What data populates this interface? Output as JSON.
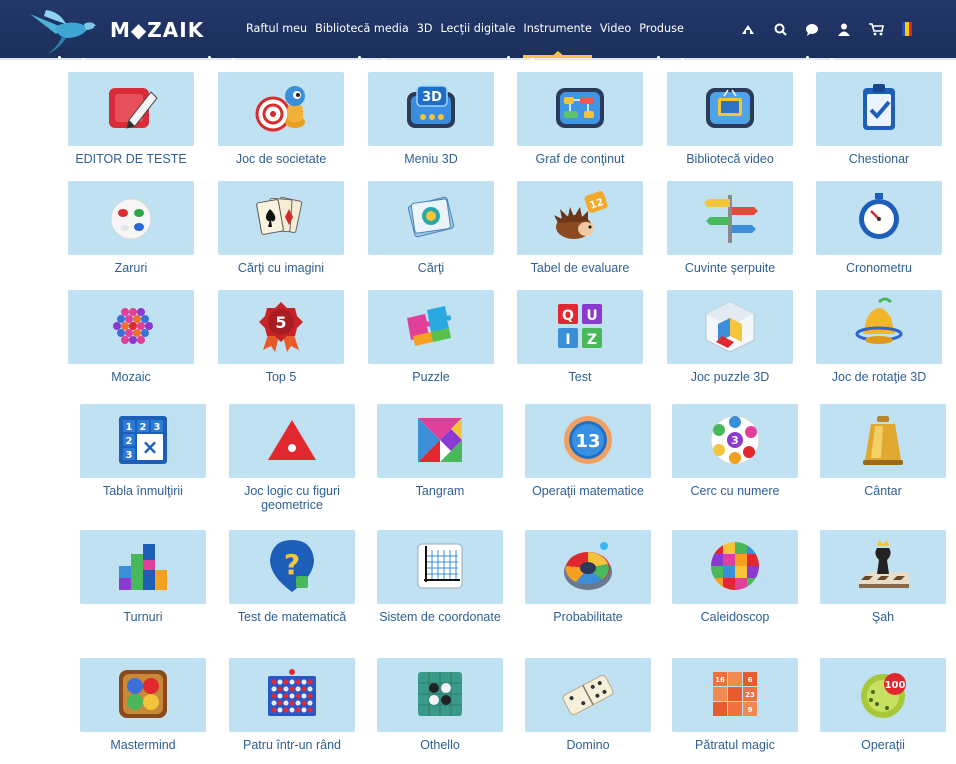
{
  "header": {
    "logo_text": "M◆ZAIK",
    "nav": [
      {
        "label": "Raftul meu"
      },
      {
        "label": "Bibliotecă media"
      },
      {
        "label": "3D"
      },
      {
        "label": "Lecţii digitale"
      },
      {
        "label": "Instrumente",
        "active": true
      },
      {
        "label": "Video"
      },
      {
        "label": "Produse"
      }
    ],
    "icons": [
      "account-lock-icon",
      "search-icon",
      "chat-icon",
      "user-icon",
      "cart-icon",
      "language-flag-icon"
    ],
    "accent_color": "#f5c542",
    "bar_color": "#22386a"
  },
  "tools": [
    {
      "label": "EDITOR DE TESTE",
      "icon": "test-editor-icon"
    },
    {
      "label": "Joc de societate",
      "icon": "board-game-icon"
    },
    {
      "label": "Meniu 3D",
      "icon": "menu-3d-icon"
    },
    {
      "label": "Graf de conţinut",
      "icon": "content-graph-icon"
    },
    {
      "label": "Bibliotecă video",
      "icon": "video-library-icon"
    },
    {
      "label": "Chestionar",
      "icon": "questionnaire-icon"
    },
    {
      "label": "Zaruri",
      "icon": "dice-icon"
    },
    {
      "label": "Cărţi cu imagini",
      "icon": "picture-cards-icon"
    },
    {
      "label": "Cărţi",
      "icon": "cards-icon"
    },
    {
      "label": "Tabel de evaluare",
      "icon": "evaluation-table-icon"
    },
    {
      "label": "Cuvinte şerpuite",
      "icon": "snake-words-icon"
    },
    {
      "label": "Cronometru",
      "icon": "stopwatch-icon"
    },
    {
      "label": "Mozaic",
      "icon": "mosaic-icon"
    },
    {
      "label": "Top 5",
      "icon": "top5-icon"
    },
    {
      "label": "Puzzle",
      "icon": "puzzle-icon"
    },
    {
      "label": "Test",
      "icon": "quiz-icon"
    },
    {
      "label": "Joc puzzle 3D",
      "icon": "puzzle-3d-icon"
    },
    {
      "label": "Joc de rotaţie 3D",
      "icon": "rotation-3d-icon"
    },
    {
      "label": "Tabla înmulţirii",
      "icon": "multiplication-table-icon"
    },
    {
      "label": "Joc logic cu figuri geometrice",
      "icon": "geometric-logic-icon"
    },
    {
      "label": "Tangram",
      "icon": "tangram-icon"
    },
    {
      "label": "Operaţii matematice",
      "icon": "math-operations-icon"
    },
    {
      "label": "Cerc cu numere",
      "icon": "number-circle-icon"
    },
    {
      "label": "Cântar",
      "icon": "scale-weight-icon"
    },
    {
      "label": "Turnuri",
      "icon": "towers-icon"
    },
    {
      "label": "Test de matematică",
      "icon": "math-test-icon"
    },
    {
      "label": "Sistem de coordonate",
      "icon": "coordinate-system-icon"
    },
    {
      "label": "Probabilitate",
      "icon": "probability-wheel-icon"
    },
    {
      "label": "Caleidoscop",
      "icon": "kaleidoscope-icon"
    },
    {
      "label": "Şah",
      "icon": "chess-icon"
    },
    {
      "label": "Mastermind",
      "icon": "mastermind-icon"
    },
    {
      "label": "Patru într-un rând",
      "icon": "four-in-a-row-icon"
    },
    {
      "label": "Othello",
      "icon": "othello-icon"
    },
    {
      "label": "Domino",
      "icon": "domino-icon"
    },
    {
      "label": "Pătratul magic",
      "icon": "magic-square-icon"
    },
    {
      "label": "Operaţii",
      "icon": "operations-icon"
    }
  ],
  "glyphs": {
    "top5": "5",
    "quiz_letters": [
      "Q",
      "U",
      "I",
      "Z"
    ],
    "multiplication": [
      "1",
      "2",
      "3",
      "2",
      "3",
      "×"
    ],
    "math_ops_number": "13",
    "number_circle_center": "3",
    "magic_square": [
      "16",
      "6",
      "23",
      "9"
    ],
    "operations_number": "100",
    "math_test_mark": "?"
  }
}
